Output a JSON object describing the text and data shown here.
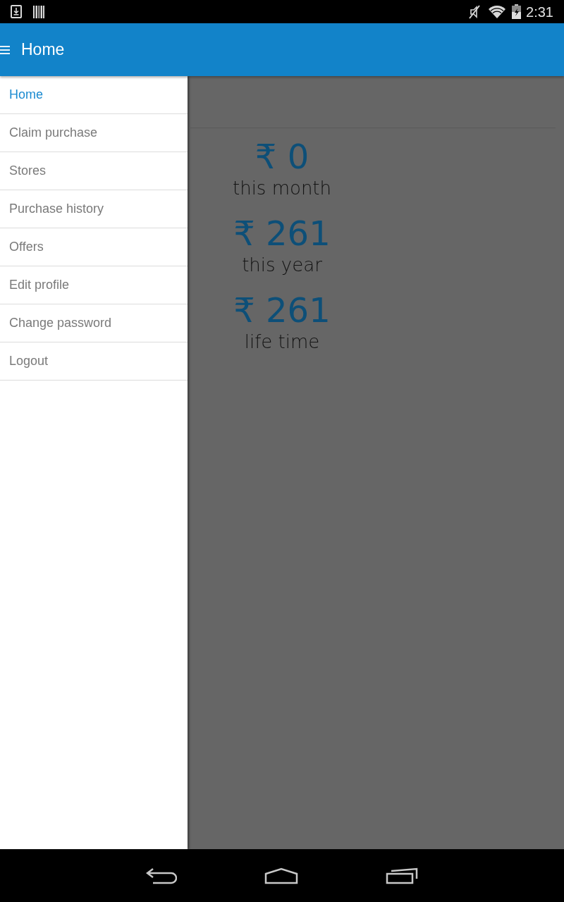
{
  "status_bar": {
    "time": "2:31"
  },
  "app_bar": {
    "title": "Home"
  },
  "drawer": {
    "items": [
      {
        "label": "Home",
        "selected": true
      },
      {
        "label": "Claim purchase",
        "selected": false
      },
      {
        "label": "Stores",
        "selected": false
      },
      {
        "label": "Purchase history",
        "selected": false
      },
      {
        "label": "Offers",
        "selected": false
      },
      {
        "label": "Edit profile",
        "selected": false
      },
      {
        "label": "Change password",
        "selected": false
      },
      {
        "label": "Logout",
        "selected": false
      }
    ]
  },
  "stats": [
    {
      "value": "₹ 0",
      "label": "this month"
    },
    {
      "value": "₹ 261",
      "label": "this year"
    },
    {
      "value": "₹ 261",
      "label": "life time"
    }
  ]
}
